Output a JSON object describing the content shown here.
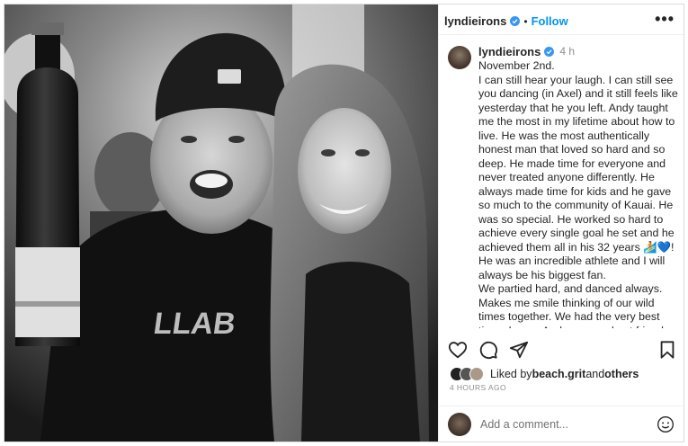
{
  "post": {
    "username": "lyndieirons",
    "follow_label": "Follow",
    "separator": "•",
    "more_label": "•••"
  },
  "caption": {
    "username": "lyndieirons",
    "time": "4 h",
    "text": "November 2nd.\nI can still hear your laugh. I can still see you dancing (in Axel) and it still feels like yesterday that he you left. Andy taught me the most in my lifetime about how to live. He was the most authentically honest man that loved so hard and so deep. He made time for everyone and never treated anyone differently. He always made time for kids and he gave so much to the community of Kauai. He was so special. He worked so hard to achieve every single goal he set and he achieved them all in his 32 years 🏄💙!\nHe was an incredible athlete and I will always be his biggest fan.\nWe partied hard, and danced always. Makes me smile thinking of our wild times together. We had the very best time always. Andy was my best friend"
  },
  "likes": {
    "prefix": "Liked by ",
    "user": "beach.grit",
    "and": " and ",
    "others": "others"
  },
  "timestamp": "4 HOURS AGO",
  "comment": {
    "placeholder": "Add a comment..."
  },
  "photo": {
    "shirt_text": "LLAB"
  },
  "icons": {
    "verified": "verified-badge-icon",
    "like": "heart-icon",
    "comment": "comment-icon",
    "share": "send-icon",
    "save": "bookmark-icon",
    "emoji": "smiley-icon"
  },
  "colors": {
    "link": "#0095f6",
    "text": "#262626",
    "muted": "#8e8e8e"
  }
}
